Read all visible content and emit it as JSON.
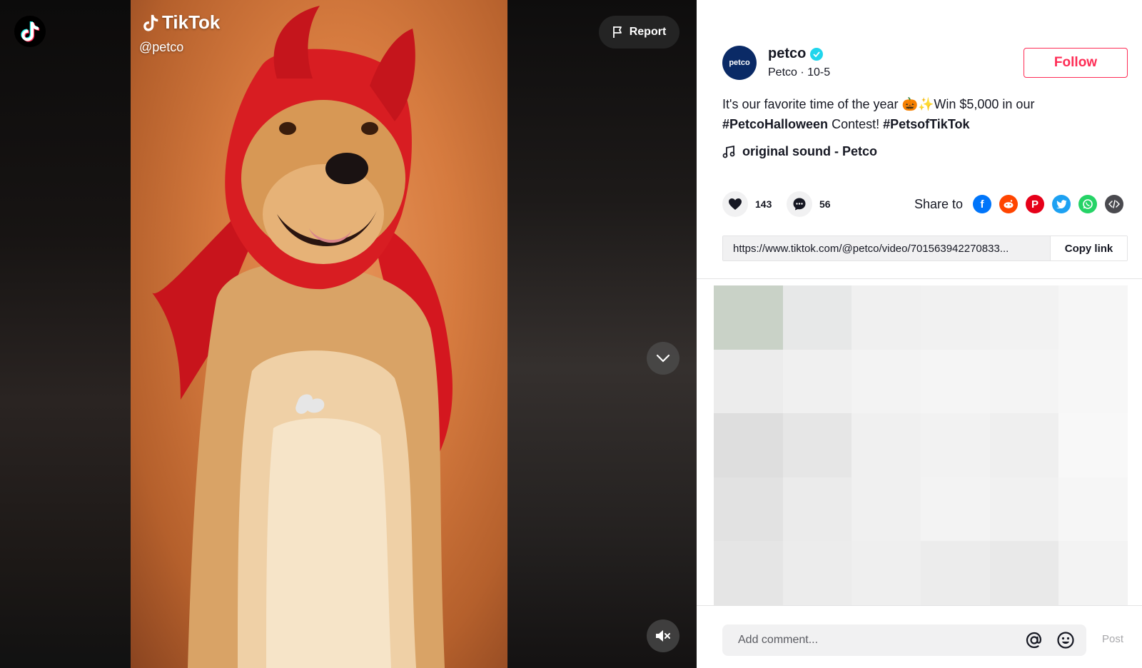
{
  "video": {
    "watermark_brand": "TikTok",
    "watermark_handle": "@petco",
    "report_label": "Report"
  },
  "author": {
    "avatar_text": "petco",
    "username": "petco",
    "subline": "Petco · 10-5",
    "follow_label": "Follow"
  },
  "caption": {
    "text_part1": "It's our favorite time of the year 🎃✨Win $5,000 in our ",
    "hashtag1": "#PetcoHalloween",
    "text_part2": " Contest! ",
    "hashtag2": "#PetsofTikTok"
  },
  "sound": {
    "label": "original sound - Petco"
  },
  "stats": {
    "likes": "143",
    "comments": "56"
  },
  "share": {
    "label": "Share to",
    "icons": [
      "facebook-icon",
      "reddit-icon",
      "pinterest-icon",
      "twitter-icon",
      "whatsapp-icon",
      "embed-icon"
    ]
  },
  "link": {
    "url": "https://www.tiktok.com/@petco/video/701563942270833...",
    "copy_label": "Copy link"
  },
  "comment": {
    "placeholder": "Add comment...",
    "post_label": "Post"
  },
  "colors": {
    "brand": "#fe2c55",
    "verified": "#20d5ec",
    "text": "#161823"
  }
}
